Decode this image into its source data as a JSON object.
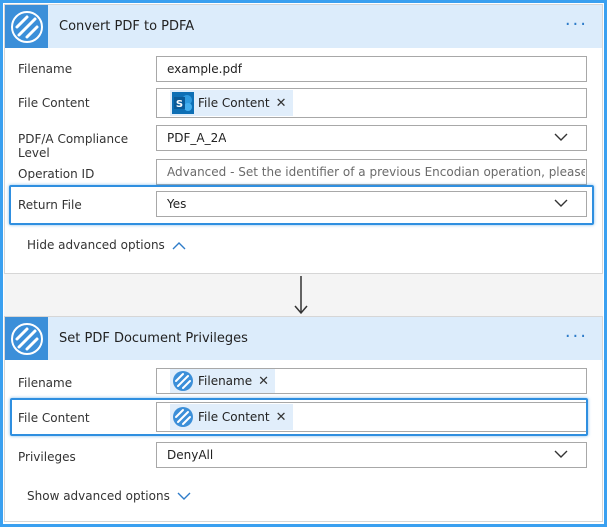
{
  "colors": {
    "accent": "#3b8fd9",
    "header_bg": "#dcecfb",
    "highlight": "#2f8fe0",
    "token_bg": "#e1eefb",
    "sharepoint": "#0e6fb5"
  },
  "card1": {
    "title": "Convert PDF to PDFA",
    "more_icon": "more-dots-icon",
    "fields": {
      "filename": {
        "label": "Filename",
        "value": "example.pdf"
      },
      "file_content": {
        "label": "File Content",
        "token": "File Content",
        "token_icon": "sharepoint-icon"
      },
      "compliance": {
        "label": "PDF/A Compliance Level",
        "value": "PDF_A_2A"
      },
      "operation_id": {
        "label": "Operation ID",
        "placeholder": "Advanced - Set the identifier of a previous Encodian operation, please review t"
      },
      "return_file": {
        "label": "Return File",
        "value": "Yes"
      }
    },
    "advanced_toggle": "Hide advanced options"
  },
  "card2": {
    "title": "Set PDF Document Privileges",
    "more_icon": "more-dots-icon",
    "fields": {
      "filename": {
        "label": "Filename",
        "token": "Filename",
        "token_icon": "encodian-icon"
      },
      "file_content": {
        "label": "File Content",
        "token": "File Content",
        "token_icon": "encodian-icon"
      },
      "privileges": {
        "label": "Privileges",
        "value": "DenyAll"
      }
    },
    "advanced_toggle": "Show advanced options"
  }
}
